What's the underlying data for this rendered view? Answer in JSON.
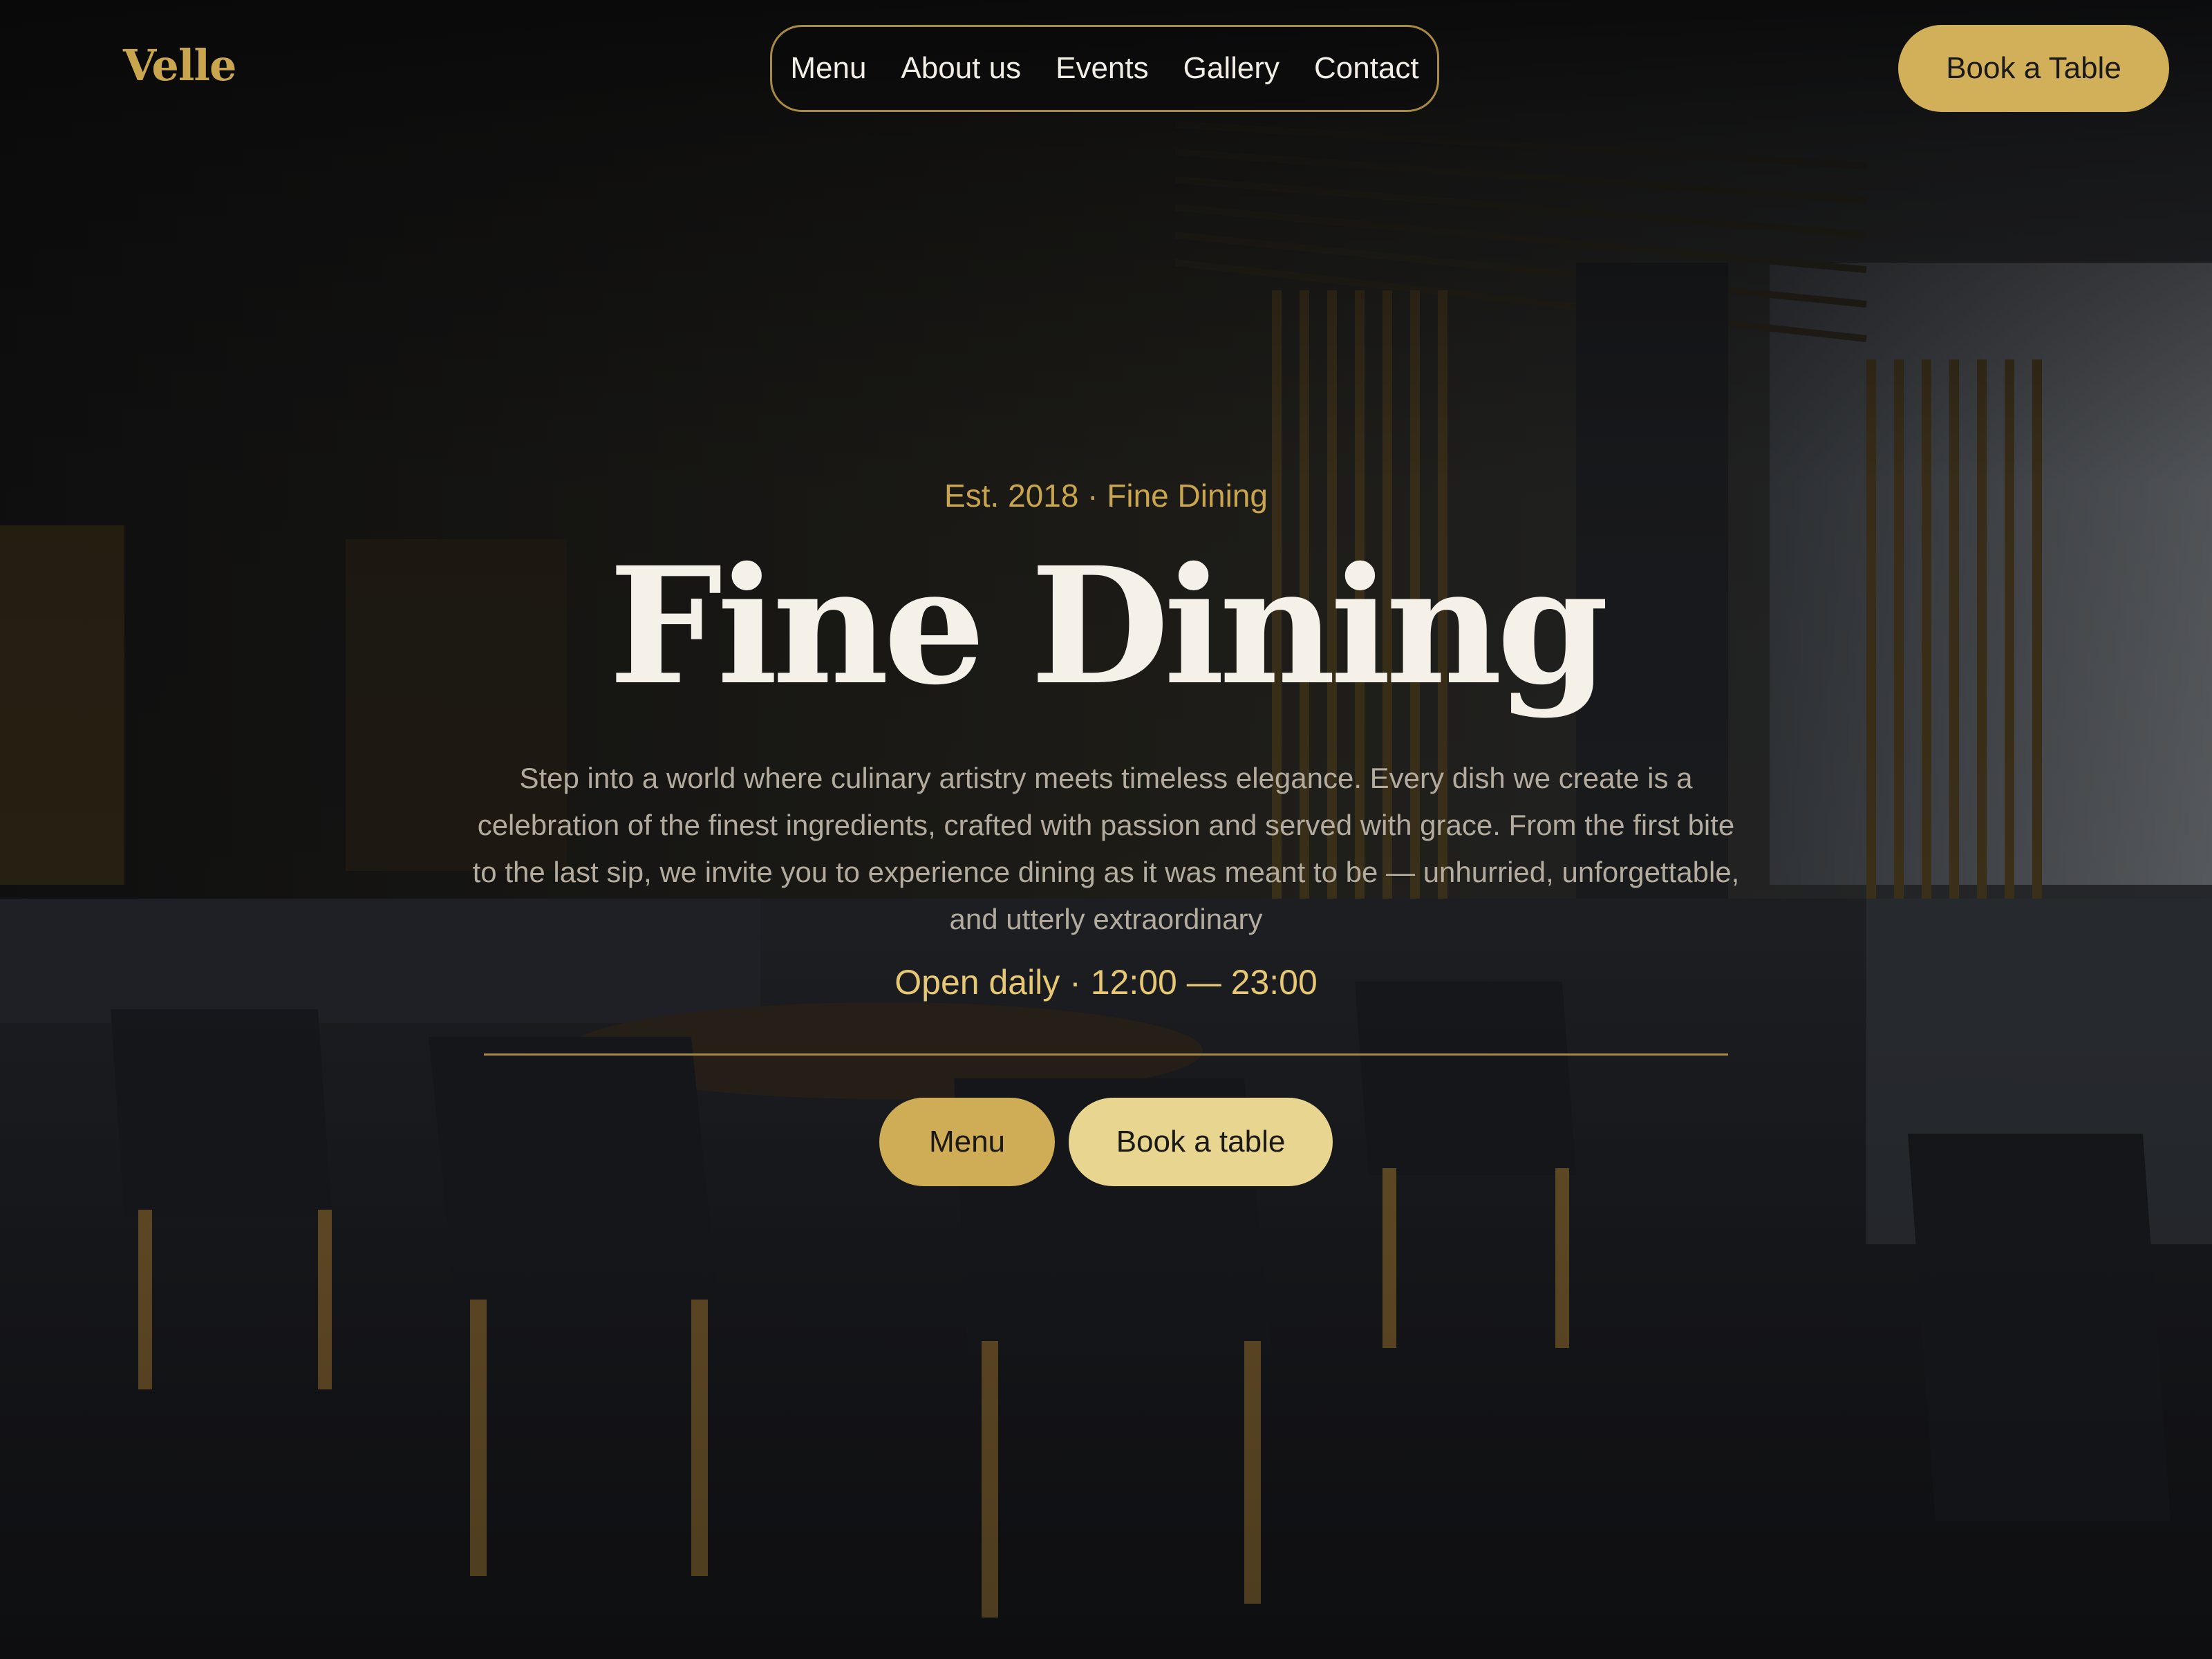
{
  "brand": {
    "name": "Velle",
    "accent_color": "#c9a64e"
  },
  "nav": {
    "items": [
      "Menu",
      "About us",
      "Events",
      "Gallery",
      "Contact"
    ]
  },
  "header": {
    "cta_label": "Book a Table"
  },
  "hero": {
    "eyebrow": "Est. 2018 · Fine Dining",
    "title": "Fine Dining",
    "description": "Step into a world where culinary artistry meets timeless elegance. Every dish we create is a celebration of the finest ingredients, crafted with passion and served with grace. From the first bite to the last sip, we invite you to experience dining as it was meant to be — unhurried, unforgettable, and utterly extraordinary",
    "hours": "Open daily · 12:00 — 23:00",
    "primary_button": "Menu",
    "secondary_button": "Book a table"
  },
  "background": {
    "subject": "restaurant-interior-photo"
  }
}
